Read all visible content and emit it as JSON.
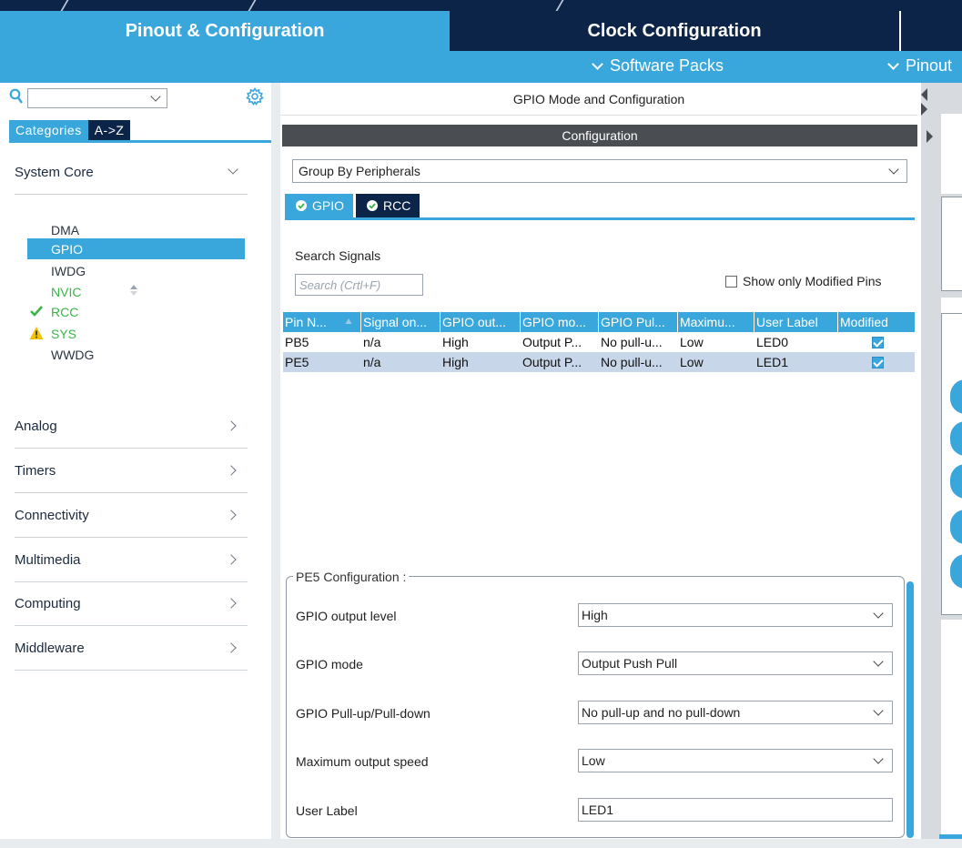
{
  "tabs": {
    "pinout": "Pinout & Configuration",
    "clock": "Clock Configuration"
  },
  "submenu": {
    "software_packs": "Software Packs",
    "pinout": "Pinout"
  },
  "left": {
    "search_value": "",
    "category_tabs": [
      "Categories",
      "A->Z"
    ],
    "categories": [
      {
        "label": "System Core",
        "expanded": true
      },
      {
        "label": "Analog"
      },
      {
        "label": "Timers"
      },
      {
        "label": "Connectivity"
      },
      {
        "label": "Multimedia"
      },
      {
        "label": "Computing"
      },
      {
        "label": "Middleware"
      }
    ],
    "core_items": [
      {
        "label": "DMA",
        "status": "none"
      },
      {
        "label": "GPIO",
        "status": "selected"
      },
      {
        "label": "IWDG",
        "status": "none"
      },
      {
        "label": "NVIC",
        "status": "green"
      },
      {
        "label": "RCC",
        "status": "ok"
      },
      {
        "label": "SYS",
        "status": "warning"
      },
      {
        "label": "WWDG",
        "status": "none"
      }
    ]
  },
  "middle": {
    "title": "GPIO Mode and Configuration",
    "config_band": "Configuration",
    "group_by": "Group By Peripherals",
    "peripheral_tabs": [
      "GPIO",
      "RCC"
    ],
    "search_signals_label": "Search Signals",
    "search_placeholder": "Search (Crtl+F)",
    "show_modified": "Show only Modified Pins",
    "table": {
      "headers": [
        "Pin N...",
        "Signal on...",
        "GPIO out...",
        "GPIO mo...",
        "GPIO Pul...",
        "Maximu...",
        "User Label",
        "Modified"
      ],
      "rows": [
        [
          "PB5",
          "n/a",
          "High",
          "Output P...",
          "No pull-u...",
          "Low",
          "LED0",
          "checked"
        ],
        [
          "PE5",
          "n/a",
          "High",
          "Output P...",
          "No pull-u...",
          "Low",
          "LED1",
          "checked"
        ]
      ]
    },
    "pin_config": {
      "legend": "PE5 Configuration :",
      "fields": [
        {
          "label": "GPIO output level",
          "value": "High"
        },
        {
          "label": "GPIO mode",
          "value": "Output Push Pull"
        },
        {
          "label": "GPIO Pull-up/Pull-down",
          "value": "No pull-up and no pull-down"
        },
        {
          "label": "Maximum output speed",
          "value": "Low"
        },
        {
          "label": "User Label",
          "value": "LED1"
        }
      ]
    }
  },
  "colors": {
    "accent": "#3aa7dc",
    "navy": "#0b2447",
    "ok_green": "#3bb44a",
    "warning_yellow": "#f2c300"
  }
}
